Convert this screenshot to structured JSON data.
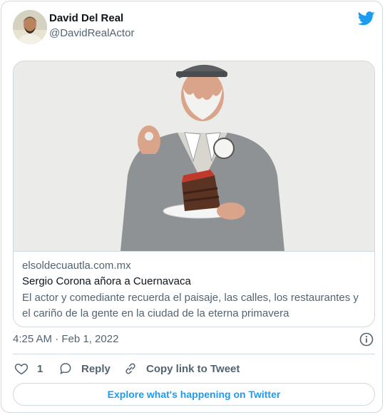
{
  "author": {
    "name": "David Del Real",
    "handle": "@DavidRealActor"
  },
  "link_card": {
    "domain": "elsoldecuautla.com.mx",
    "title": "Sergio Corona añora a Cuernavaca",
    "description": "El actor y comediante recuerda el paisaje, las calles, los restaurantes y el cariño de la gente en la ciudad de la eterna primavera"
  },
  "meta": {
    "timestamp": "4:25 AM · Feb 1, 2022"
  },
  "actions": {
    "like_count": "1",
    "reply_label": "Reply",
    "copy_label": "Copy link to Tweet"
  },
  "footer": {
    "explore_label": "Explore what's happening on Twitter"
  },
  "colors": {
    "accent": "#1d9bf0",
    "secondary_text": "#536471",
    "border": "#cfd9de"
  },
  "icons": [
    "twitter-bird-icon",
    "info-icon",
    "heart-icon",
    "reply-icon",
    "link-icon"
  ]
}
